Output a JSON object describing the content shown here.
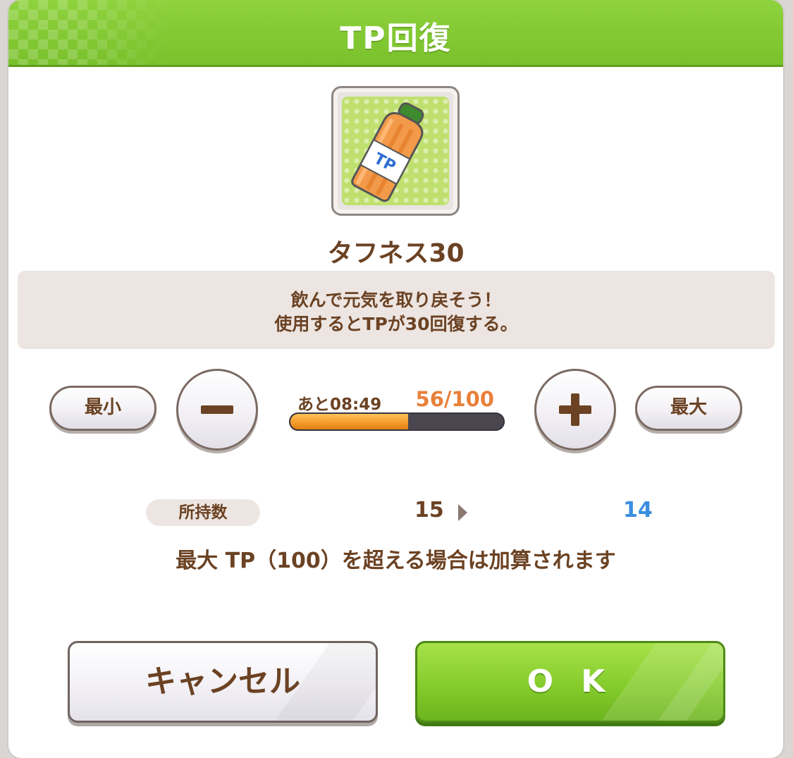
{
  "dialog": {
    "title": "TP回復",
    "item_name": "タフネス30",
    "item_icon": "tp-bottle-icon",
    "description": [
      "飲んで元気を取り戻そう！",
      "使用するとTPが30回復する。"
    ]
  },
  "tp": {
    "remaining_label": "あと08:49",
    "value_text": "56/100",
    "current": 56,
    "max": 100
  },
  "controls": {
    "min_label": "最小",
    "max_label": "最大",
    "decrement_icon": "minus-icon",
    "increment_icon": "plus-icon"
  },
  "owned": {
    "label": "所持数",
    "before": "15",
    "after": "14"
  },
  "note": "最大 TP（100）を超える場合は加算されます",
  "buttons": {
    "cancel": "キャンセル",
    "ok": "O K"
  },
  "colors": {
    "header": "#79c12c",
    "text_brown": "#6b4223",
    "tp_orange": "#e9803a",
    "after_blue": "#3a8ee0",
    "ok_green": "#85cc2c"
  }
}
